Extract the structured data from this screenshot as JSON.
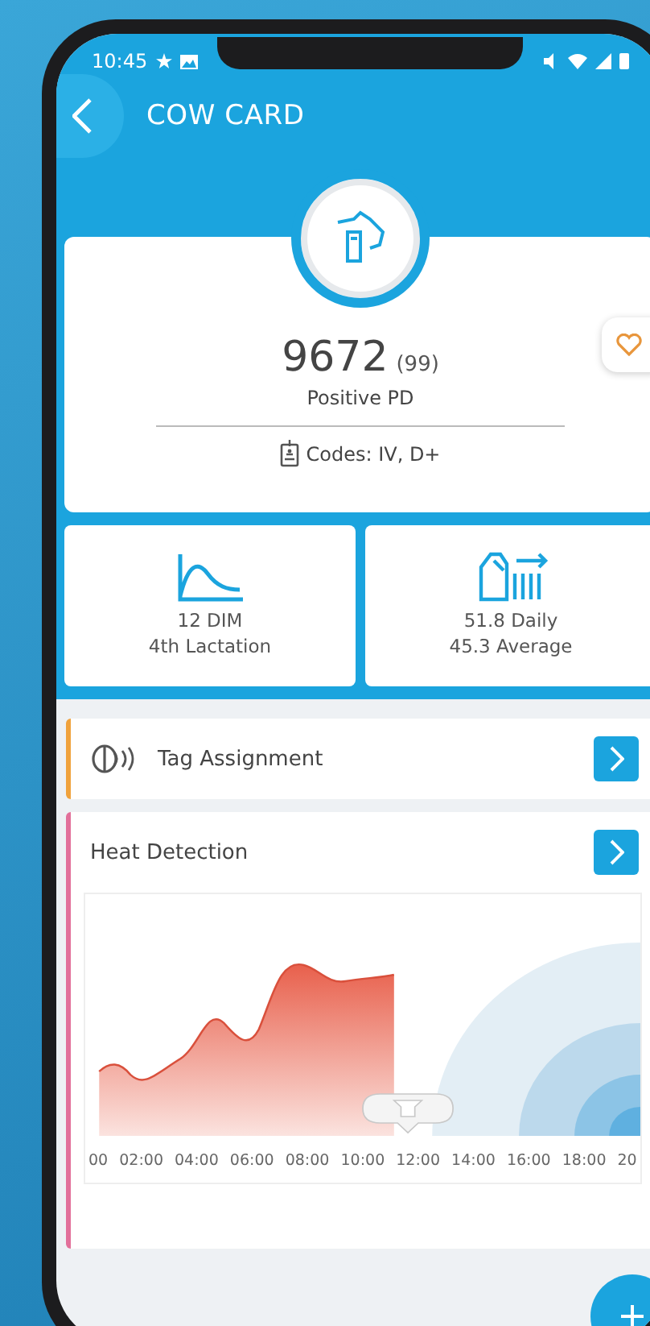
{
  "status_bar": {
    "time": "10:45"
  },
  "header": {
    "title": "COW CARD"
  },
  "cow": {
    "number": "9672",
    "lactation_count": "(99)",
    "status": "Positive PD",
    "codes": "Codes: IV, D+",
    "favorite": false
  },
  "stats": [
    {
      "kind": "lactation",
      "lines": [
        "12 DIM",
        "4th Lactation"
      ]
    },
    {
      "kind": "milk",
      "lines": [
        "51.8 Daily",
        "45.3 Average"
      ]
    }
  ],
  "sections": [
    {
      "kind": "tag",
      "label": "Tag Assignment",
      "color": "#f0a23c"
    },
    {
      "kind": "heat",
      "label": "Heat Detection",
      "color": "#e2709a",
      "time_labels": [
        "00",
        "02:00",
        "04:00",
        "06:00",
        "08:00",
        "10:00",
        "12:00",
        "14:00",
        "16:00",
        "18:00",
        "20"
      ]
    }
  ]
}
